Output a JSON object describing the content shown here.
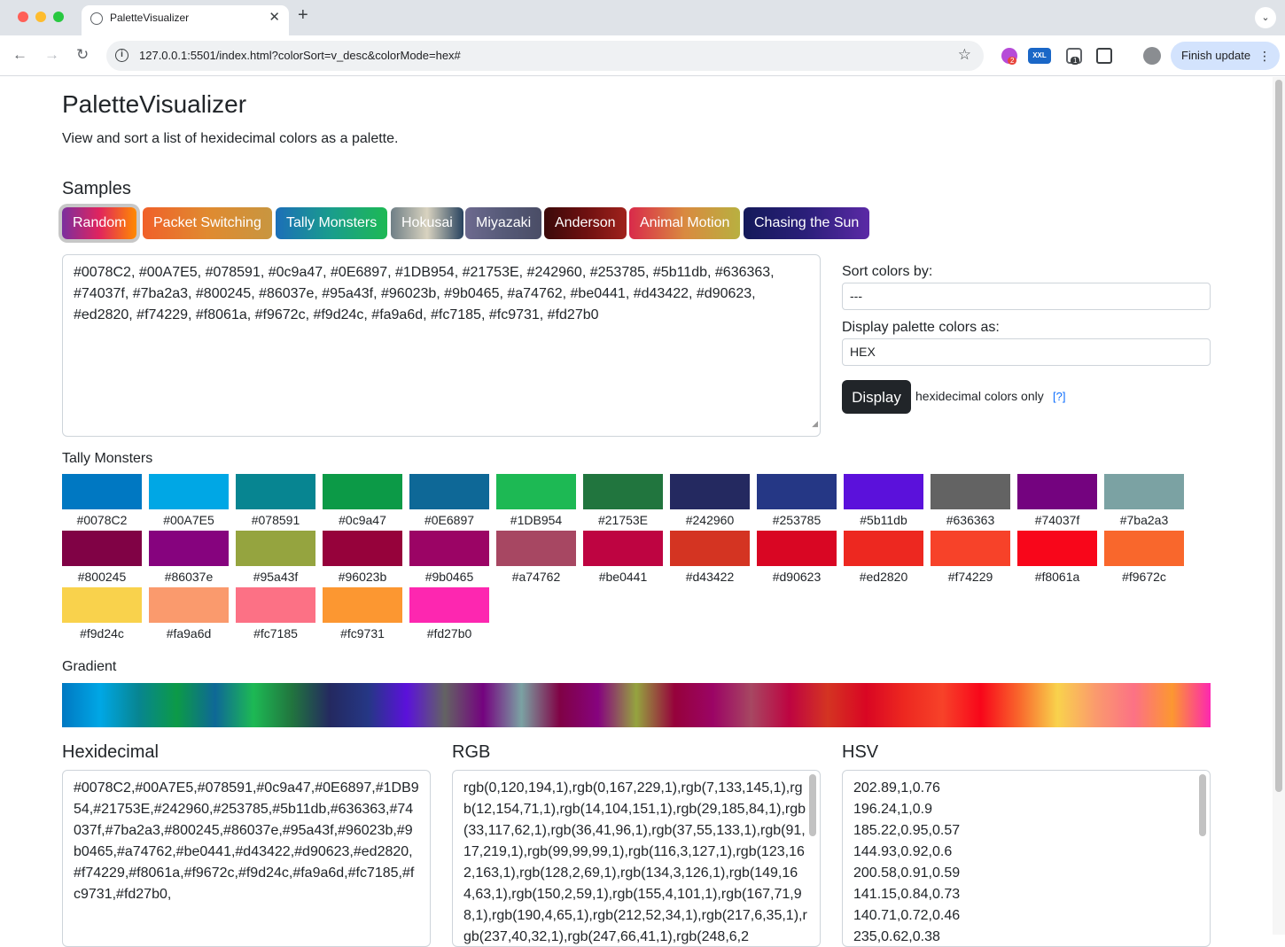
{
  "browser": {
    "tab_title": "PaletteVisualizer",
    "url": "127.0.0.1:5501/index.html?colorSort=v_desc&colorMode=hex#",
    "finish_update": "Finish update",
    "ext_badge_1": "2",
    "ext_label_2": "XXL",
    "ext_badge_3": "1"
  },
  "header": {
    "title": "PaletteVisualizer",
    "description": "View and sort a list of hexidecimal colors as a palette."
  },
  "samples": {
    "title": "Samples",
    "buttons": [
      {
        "label": "Random",
        "active": true,
        "gradient": "linear-gradient(90deg, #7b2f9e, #e0245e, #ff8a00)"
      },
      {
        "label": "Packet Switching",
        "gradient": "linear-gradient(90deg, #f0602a, #e08a30, #c89640)"
      },
      {
        "label": "Tally Monsters",
        "gradient": "linear-gradient(90deg, #1c6fb8, #1a9d8c, #1db954)"
      },
      {
        "label": "Hokusai",
        "gradient": "linear-gradient(90deg, #6f7f86, #d9d3c0, #27425e)"
      },
      {
        "label": "Miyazaki",
        "gradient": "linear-gradient(90deg, #6d6a8f, #565a78, #4a4d66)"
      },
      {
        "label": "Anderson",
        "gradient": "linear-gradient(90deg, #3b0a0a, #6d1010, #a0221c)"
      },
      {
        "label": "Animal Motion",
        "gradient": "linear-gradient(90deg, #d92a4a, #d98a40, #b8b040)"
      },
      {
        "label": "Chasing the Sun",
        "gradient": "linear-gradient(90deg, #141a5a, #2b1f7a, #5b2aa6)"
      }
    ]
  },
  "input": {
    "value": "#0078C2, #00A7E5, #078591, #0c9a47, #0E6897, #1DB954, #21753E, #242960, #253785, #5b11db, #636363, #74037f, #7ba2a3, #800245, #86037e, #95a43f, #96023b, #9b0465, #a74762, #be0441, #d43422, #d90623, #ed2820, #f74229, #f8061a, #f9672c, #f9d24c, #fa9a6d, #fc7185, #fc9731, #fd27b0"
  },
  "controls": {
    "sort_label": "Sort colors by:",
    "sort_value": "---",
    "display_label": "Display palette colors as:",
    "display_value": "HEX",
    "display_button": "Display",
    "hex_note": "hexidecimal colors only",
    "help_link": "[?]"
  },
  "palette": {
    "title": "Tally Monsters",
    "colors": [
      "#0078C2",
      "#00A7E5",
      "#078591",
      "#0c9a47",
      "#0E6897",
      "#1DB954",
      "#21753E",
      "#242960",
      "#253785",
      "#5b11db",
      "#636363",
      "#74037f",
      "#7ba2a3",
      "#800245",
      "#86037e",
      "#95a43f",
      "#96023b",
      "#9b0465",
      "#a74762",
      "#be0441",
      "#d43422",
      "#d90623",
      "#ed2820",
      "#f74229",
      "#f8061a",
      "#f9672c",
      "#f9d24c",
      "#fa9a6d",
      "#fc7185",
      "#fc9731",
      "#fd27b0"
    ]
  },
  "gradient": {
    "title": "Gradient"
  },
  "outputs": {
    "hex_title": "Hexidecimal",
    "hex_value": "#0078C2,#00A7E5,#078591,#0c9a47,#0E6897,#1DB954,#21753E,#242960,#253785,#5b11db,#636363,#74037f,#7ba2a3,#800245,#86037e,#95a43f,#96023b,#9b0465,#a74762,#be0441,#d43422,#d90623,#ed2820,#f74229,#f8061a,#f9672c,#f9d24c,#fa9a6d,#fc7185,#fc9731,#fd27b0,",
    "rgb_title": "RGB",
    "rgb_value": "rgb(0,120,194,1),rgb(0,167,229,1),rgb(7,133,145,1),rgb(12,154,71,1),rgb(14,104,151,1),rgb(29,185,84,1),rgb(33,117,62,1),rgb(36,41,96,1),rgb(37,55,133,1),rgb(91,17,219,1),rgb(99,99,99,1),rgb(116,3,127,1),rgb(123,162,163,1),rgb(128,2,69,1),rgb(134,3,126,1),rgb(149,164,63,1),rgb(150,2,59,1),rgb(155,4,101,1),rgb(167,71,98,1),rgb(190,4,65,1),rgb(212,52,34,1),rgb(217,6,35,1),rgb(237,40,32,1),rgb(247,66,41,1),rgb(248,6,2",
    "hsv_title": "HSV",
    "hsv_lines": [
      "202.89,1,0.76",
      "196.24,1,0.9",
      "185.22,0.95,0.57",
      "144.93,0.92,0.6",
      "200.58,0.91,0.59",
      "141.15,0.84,0.73",
      "140.71,0.72,0.46",
      "235,0.62,0.38"
    ]
  }
}
